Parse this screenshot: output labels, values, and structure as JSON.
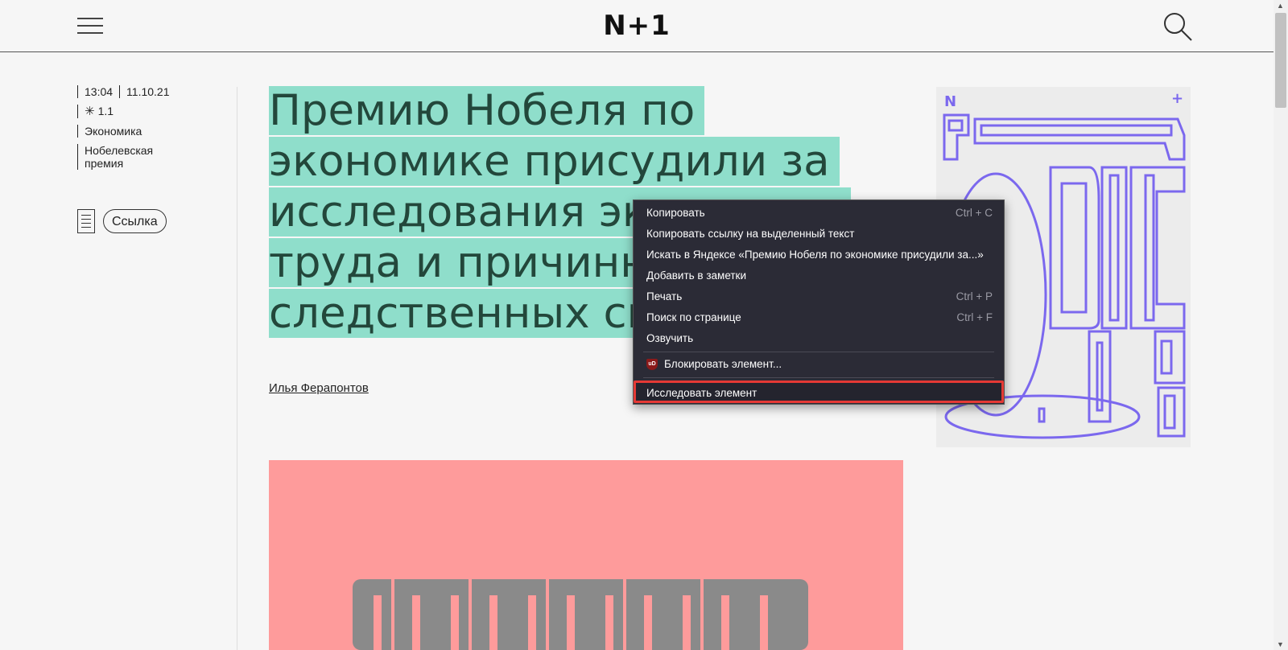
{
  "header": {
    "logo": "N+1",
    "menu_icon": "hamburger-menu-icon",
    "search_icon": "search-icon"
  },
  "meta": {
    "time": "13:04",
    "date": "11.10.21",
    "difficulty_icon": "asterisk-icon",
    "difficulty": "1.1",
    "category": "Экономика",
    "tag": "Нобелевская премия"
  },
  "actions": {
    "doc_icon": "document-icon",
    "link_label": "Ссылка"
  },
  "article": {
    "title_lines": [
      "Премию Нобеля по",
      "экономике присудили за",
      "исследования экономики",
      "труда и причинно-",
      "следственных связей"
    ],
    "author": "Илья Ферапонтов"
  },
  "poster": {
    "corner_left": "N",
    "corner_right": "+"
  },
  "context_menu": {
    "items": [
      {
        "label": "Копировать",
        "shortcut": "Ctrl + C"
      },
      {
        "label": "Копировать ссылку на выделенный текст",
        "shortcut": ""
      },
      {
        "label": "Искать в Яндексе «Премию Нобеля по экономике присудили за...»",
        "shortcut": ""
      },
      {
        "label": "Добавить в заметки",
        "shortcut": ""
      },
      {
        "label": "Печать",
        "shortcut": "Ctrl + P"
      },
      {
        "label": "Поиск по странице",
        "shortcut": "Ctrl + F"
      },
      {
        "label": "Озвучить",
        "shortcut": ""
      }
    ],
    "ublock_label": "Блокировать элемент...",
    "ublock_icon": "ublock-origin-icon",
    "ublock_badge": "uD",
    "inspect_label": "Исследовать элемент",
    "highlight_color": "#e53935"
  },
  "colors": {
    "title_highlight": "#8fdecb",
    "title_text": "#23473b",
    "pink_image": "#fe9b9b",
    "poster_stroke": "#7b68ee"
  }
}
